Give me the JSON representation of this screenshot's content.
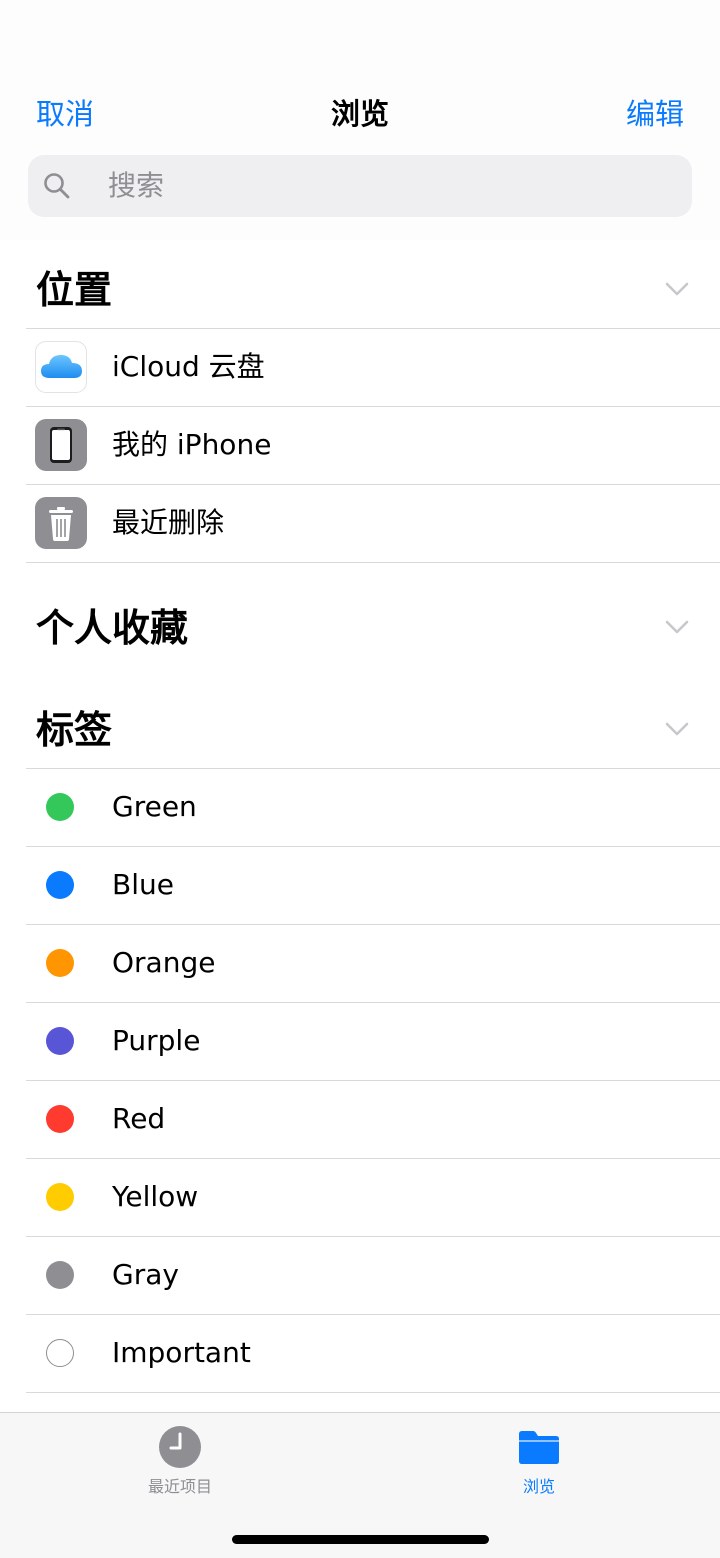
{
  "nav": {
    "cancel": "取消",
    "title": "浏览",
    "edit": "编辑"
  },
  "search": {
    "placeholder": "搜索"
  },
  "sections": {
    "locations": {
      "title": "位置",
      "items": [
        {
          "label": "iCloud 云盘",
          "icon": "icloud-icon"
        },
        {
          "label": "我的 iPhone",
          "icon": "iphone-icon"
        },
        {
          "label": "最近删除",
          "icon": "trash-icon"
        }
      ]
    },
    "favorites": {
      "title": "个人收藏"
    },
    "tags": {
      "title": "标签",
      "items": [
        {
          "label": "Green",
          "color": "#34c759"
        },
        {
          "label": "Blue",
          "color": "#0a7aff"
        },
        {
          "label": "Orange",
          "color": "#ff9500"
        },
        {
          "label": "Purple",
          "color": "#5856d6"
        },
        {
          "label": "Red",
          "color": "#ff3b30"
        },
        {
          "label": "Yellow",
          "color": "#ffcc00"
        },
        {
          "label": "Gray",
          "color": "#8e8e93"
        },
        {
          "label": "Important",
          "color": "none"
        }
      ]
    }
  },
  "tabbar": {
    "recent": {
      "label": "最近项目",
      "color": "#8e8e93",
      "icon": "clock-icon"
    },
    "browse": {
      "label": "浏览",
      "color": "#0a7aff",
      "icon": "folder-icon"
    }
  },
  "colors": {
    "accent": "#0a7aff"
  }
}
